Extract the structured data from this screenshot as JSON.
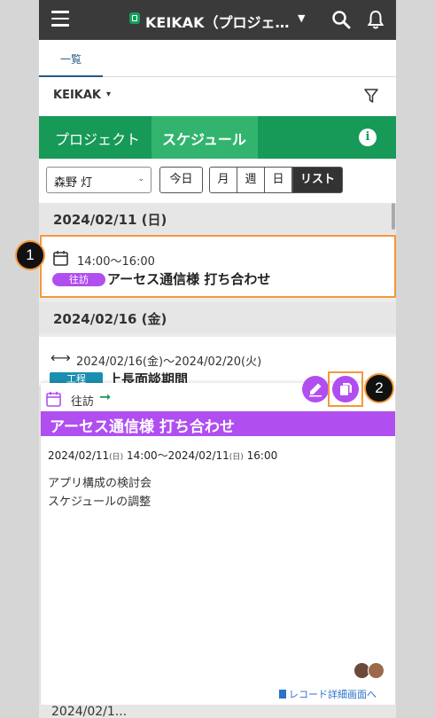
{
  "colors": {
    "topbar": "#3a3a3a",
    "brand_green": "#179a57",
    "active_tab_green": "#32b46f",
    "event_purple": "#b04ef0",
    "process_teal": "#1a8fb0",
    "highlight_orange": "#f5983a"
  },
  "topbar": {
    "title": "KEIKAK（プロジェ…",
    "icons": [
      "hamburger-menu-icon",
      "app-logo-icon",
      "caret-down-icon",
      "search-icon",
      "bell-icon"
    ]
  },
  "tabs": {
    "list_label": "一覧"
  },
  "filter": {
    "app_name": "KEIKAK",
    "caret": "▾"
  },
  "view_tabs": {
    "project": "プロジェクト",
    "schedule": "スケジュール",
    "info": "i"
  },
  "controls": {
    "user": "森野 灯",
    "today": "今日",
    "month": "月",
    "week": "週",
    "day": "日",
    "list": "リスト"
  },
  "schedule": {
    "groups": [
      {
        "date": "2024/02/11 (日)",
        "events": [
          {
            "time": "14:00～16:00",
            "badge": "往訪",
            "title": "アーセス通信様 打ち合わせ"
          }
        ]
      },
      {
        "date": "2024/02/16 (金)",
        "events": [
          {
            "time": "2024/02/16(金)～2024/02/20(火)",
            "badge": "工程",
            "title": "上長面談期間"
          }
        ]
      }
    ],
    "next_date_partial": "2024/02/1..."
  },
  "popup": {
    "type_label": "往訪",
    "arrow": "➞",
    "title": "アーセス通信様 打ち合わせ",
    "start_date": "2024/02/11",
    "start_wd": "(日)",
    "start_time": "14:00～",
    "end_date": "2024/02/11",
    "end_wd": "(日)",
    "end_time": "16:00",
    "notes": [
      "アプリ構成の検討会",
      "スケジュールの調整"
    ],
    "detail_link": "レコード詳細画面へ"
  },
  "markers": {
    "one": "1",
    "two": "2"
  }
}
